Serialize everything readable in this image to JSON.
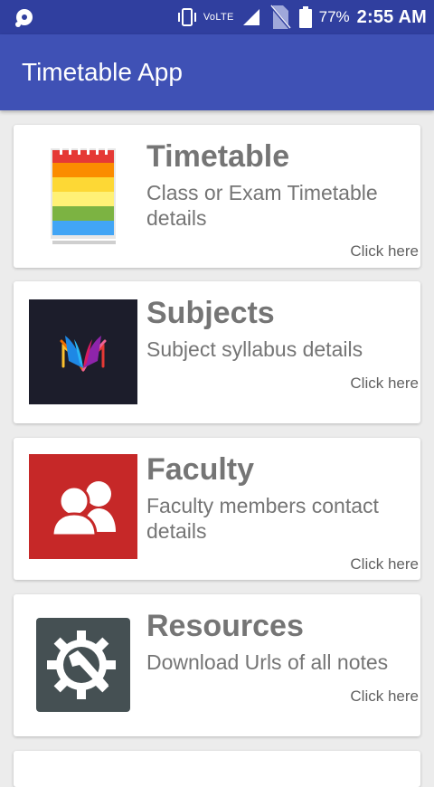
{
  "status_bar": {
    "network_label": "VoLTE",
    "battery_percent": "77%",
    "time": "2:55 AM",
    "icons": [
      "notification-icon",
      "vibrate-icon",
      "signal-icon",
      "no-sim-icon",
      "battery-icon"
    ]
  },
  "app_bar": {
    "title": "Timetable App",
    "color": "#3f51b5",
    "status_color": "#303f9f"
  },
  "cards": [
    {
      "title": "Timetable",
      "description": "Class or Exam Timetable details",
      "action": "Click here",
      "icon": "timetable-notepad-icon"
    },
    {
      "title": "Subjects",
      "description": "Subject syllabus details",
      "action": "Click here",
      "icon": "book-icon"
    },
    {
      "title": "Faculty",
      "description": "Faculty members contact details",
      "action": "Click here",
      "icon": "people-icon"
    },
    {
      "title": "Resources",
      "description": "Download Urls of all notes",
      "action": "Click here",
      "icon": "settings-wrench-icon"
    }
  ]
}
